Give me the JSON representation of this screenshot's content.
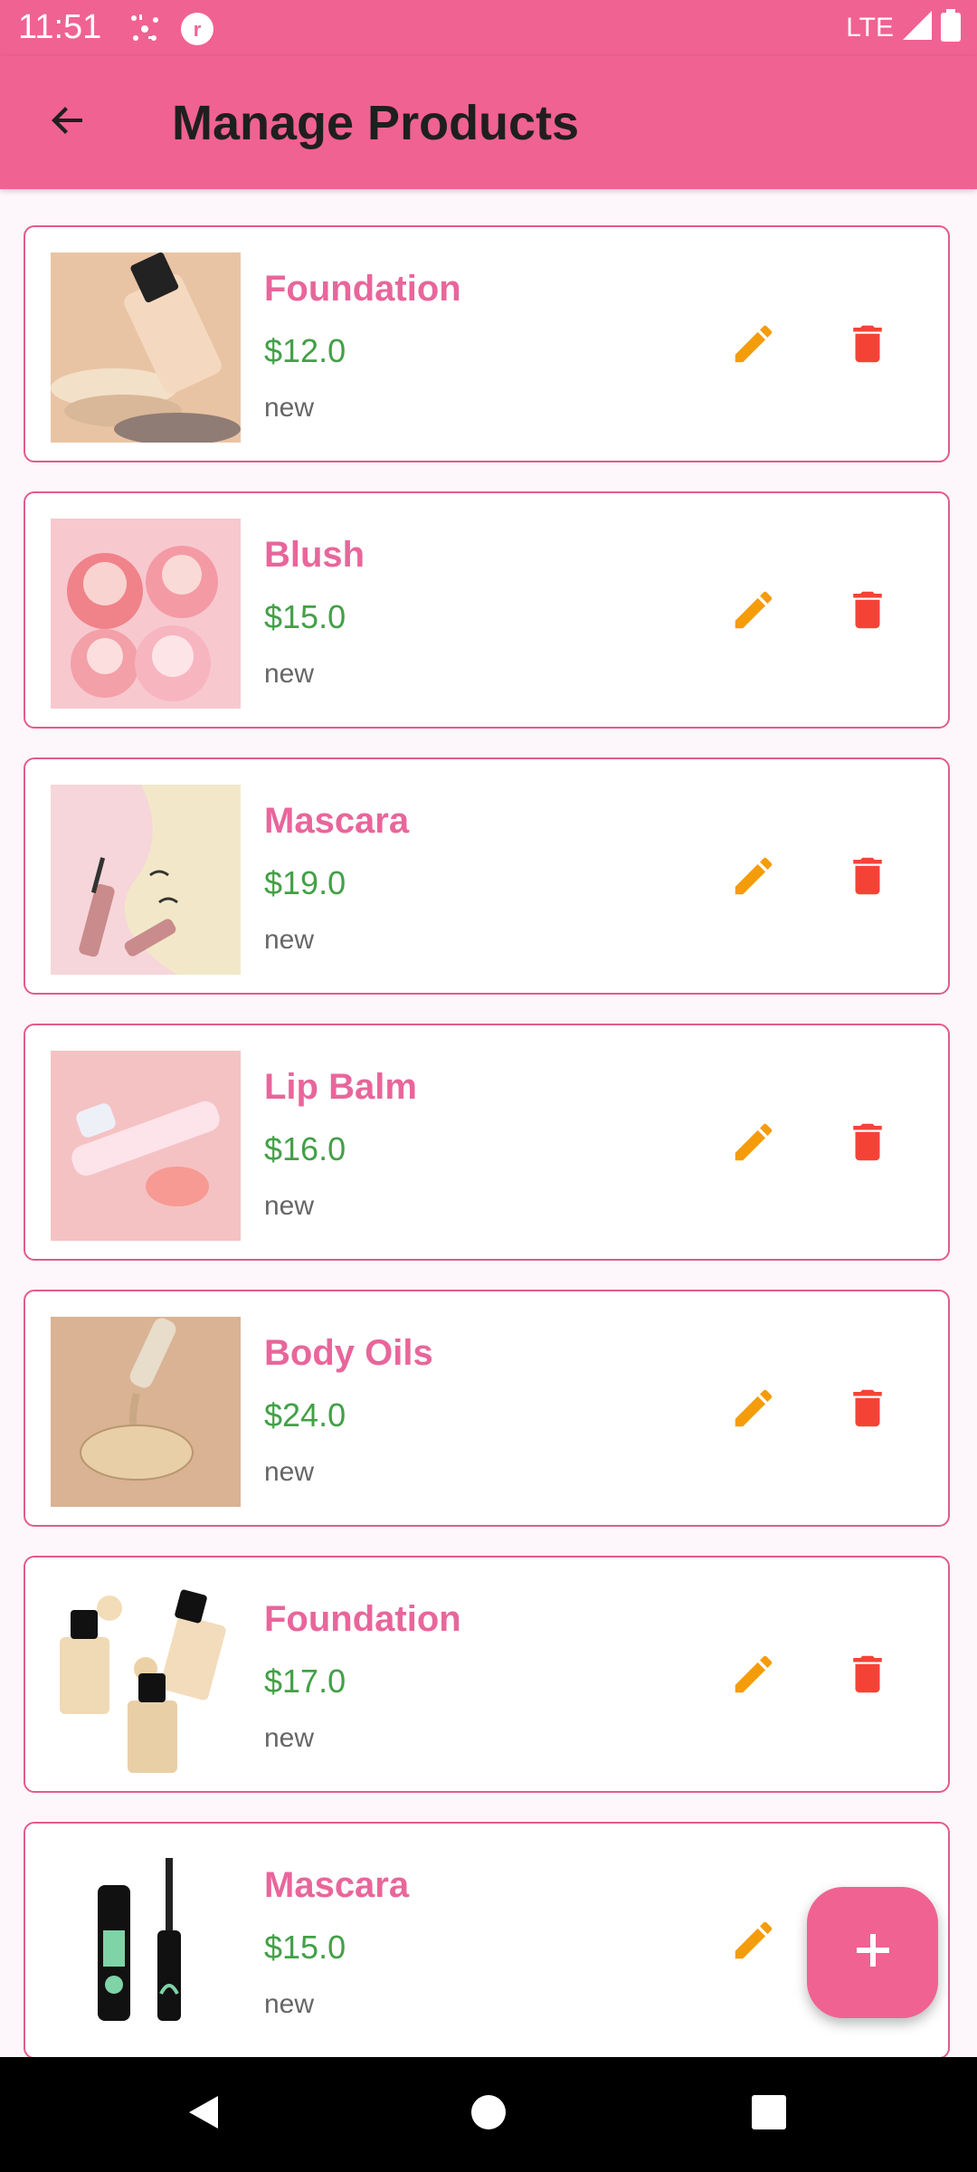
{
  "status_bar": {
    "time": "11:51",
    "network": "LTE",
    "icons": [
      "birthday-notification-icon",
      "app-notification-icon",
      "signal-icon",
      "battery-icon"
    ]
  },
  "app_bar": {
    "title": "Manage Products",
    "back_icon": "arrow-back-icon"
  },
  "products": [
    {
      "name": "Foundation",
      "price": "$12.0",
      "condition": "new",
      "image": "foundation-bottle-swatches"
    },
    {
      "name": "Blush",
      "price": "$15.0",
      "condition": "new",
      "image": "heart-blush-compacts"
    },
    {
      "name": "Mascara",
      "price": "$19.0",
      "condition": "new",
      "image": "mascara-wand-lashes"
    },
    {
      "name": "Lip Balm",
      "price": "$16.0",
      "condition": "new",
      "image": "lip-gloss-tube"
    },
    {
      "name": "Body Oils",
      "price": "$24.0",
      "condition": "new",
      "image": "oil-dropper"
    },
    {
      "name": "Foundation",
      "price": "$17.0",
      "condition": "new",
      "image": "foundation-bottles"
    },
    {
      "name": "Mascara",
      "price": "$15.0",
      "condition": "new",
      "image": "lash-mascara-tube"
    }
  ],
  "actions": {
    "edit_icon": "pencil-icon",
    "delete_icon": "trash-icon",
    "add_icon": "plus-icon"
  },
  "colors": {
    "primary": "#f06292",
    "product_name": "#e8669b",
    "price": "#43a047",
    "edit": "#f59c0b",
    "delete": "#f44336",
    "card_border": "#e25b8c"
  }
}
